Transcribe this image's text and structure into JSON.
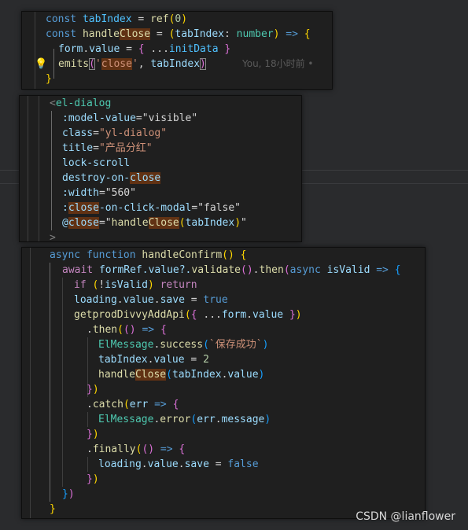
{
  "snippet1": {
    "l1": {
      "kw": "const",
      "name": "tabIndex",
      "eq": " = ",
      "call": "ref",
      "open": "(",
      "num": "0",
      "close": ")"
    },
    "l2": {
      "kw": "const",
      "name": "handleClose",
      "hl": "Close",
      "eq": " = ",
      "popen": "(",
      "param": "tabIndex",
      "colon": ": ",
      "ptype": "number",
      "pclose": ")",
      "arrow": " => ",
      "brace": "{"
    },
    "l3": {
      "obj": "form",
      "dot": ".",
      "prop": "value",
      "eq": " = ",
      "open": "{ ",
      "spread": "...",
      "init": "initData",
      "close": " }"
    },
    "l4": {
      "fn": "emits",
      "open": "(",
      "str_q1": "'",
      "str_hl": "close",
      "str_q2": "'",
      "comma": ", ",
      "arg": "tabIndex",
      "close": ")",
      "blame": "You, 18小时前 •"
    },
    "l5": {
      "close": "}"
    }
  },
  "snippet2": {
    "l1": {
      "open": "<",
      "tag": "el-dialog"
    },
    "l2": {
      "attr": ":model-value",
      "eq": "=",
      "val": "\"visible\""
    },
    "l3": {
      "attr": "class",
      "eq": "=",
      "val": "\"yl-dialog\""
    },
    "l4": {
      "attr": "title",
      "eq": "=",
      "val": "\"产品分红\""
    },
    "l5": {
      "attr": "lock-scroll"
    },
    "l6": {
      "attr": "destroy-on-",
      "hl": "close"
    },
    "l7": {
      "attr": ":width",
      "eq": "=",
      "val": "\"560\""
    },
    "l8": {
      "colon": ":",
      "hl": "close",
      "attr": "-on-click-modal",
      "eq": "=",
      "val": "\"false\""
    },
    "l9": {
      "at": "@",
      "hl": "close",
      "eq": "=",
      "q1": "\"",
      "fn1": "handle",
      "fn_hl": "Close",
      "popen": "(",
      "arg": "tabIndex",
      "pclose": ")",
      "q2": "\""
    },
    "l10": {
      "text": ">"
    }
  },
  "snippet3": {
    "l1": {
      "kw": "async",
      "kw2": "function",
      "fn": "handleConfirm",
      "parens": "()",
      "brace": " {"
    },
    "l2": {
      "kw": "await",
      "obj": "formRef",
      "p1": ".value?.",
      "fn": "validate",
      "call": "()",
      "dot": ".",
      "fn2": "then",
      "open": "(",
      "kw2": "async",
      "param": "isValid",
      "arrow": " => ",
      "brace": "{"
    },
    "l3": {
      "kw": "if",
      "open": " (",
      "not": "!",
      "var": "isValid",
      "close": ") ",
      "kw2": "return"
    },
    "l4": {
      "obj": "loading",
      "dot1": ".",
      "p1": "value",
      "dot2": ".",
      "p2": "save",
      "eq": " = ",
      "val": "true"
    },
    "l5": {
      "fn": "getprodDivvyAddApi",
      "open": "(",
      "brace": "{ ",
      "spread": "...",
      "obj": "form",
      "dot": ".",
      "prop": "value",
      "bclose": " }",
      "close": ")"
    },
    "l6": {
      "dot": ".",
      "fn": "then",
      "open": "(",
      "parens": "()",
      "arrow": " => ",
      "brace": "{"
    },
    "l7": {
      "obj": "ElMessage",
      "dot": ".",
      "fn": "success",
      "open": "(",
      "str": "`保存成功`",
      "close": ")"
    },
    "l8": {
      "obj": "tabIndex",
      "dot": ".",
      "prop": "value",
      "eq": " = ",
      "num": "2"
    },
    "l9": {
      "fn1": "handle",
      "fn_hl": "Close",
      "open": "(",
      "obj": "tabIndex",
      "dot": ".",
      "prop": "value",
      "close": ")"
    },
    "l10": {
      "brace": "}",
      "close": ")"
    },
    "l11": {
      "dot": ".",
      "fn": "catch",
      "open": "(",
      "param": "err",
      "arrow": " => ",
      "brace": "{"
    },
    "l12": {
      "obj": "ElMessage",
      "dot": ".",
      "fn": "error",
      "open": "(",
      "arg": "err",
      "dot2": ".",
      "prop": "message",
      "close": ")"
    },
    "l13": {
      "brace": "}",
      "close": ")"
    },
    "l14": {
      "dot": ".",
      "fn": "finally",
      "open": "(",
      "parens": "()",
      "arrow": " => ",
      "brace": "{"
    },
    "l15": {
      "obj": "loading",
      "dot1": ".",
      "p1": "value",
      "dot2": ".",
      "p2": "save",
      "eq": " = ",
      "val": "false"
    },
    "l16": {
      "brace": "}",
      "close": ")"
    },
    "l17": {
      "brace": "}",
      "close": ")"
    },
    "l18": {
      "close": "}"
    }
  },
  "icons": {
    "lightbulb": "lightbulb-icon"
  },
  "watermark": "CSDN @lianflower",
  "colors": {
    "keyword": "#569cd6",
    "control": "#c586c0",
    "function": "#dcdcaa",
    "variable": "#9cdcfe",
    "string": "#ce9178",
    "number": "#b5cea8",
    "type": "#4ec9b0",
    "highlight": "#613214",
    "background": "#1f1f1f"
  }
}
